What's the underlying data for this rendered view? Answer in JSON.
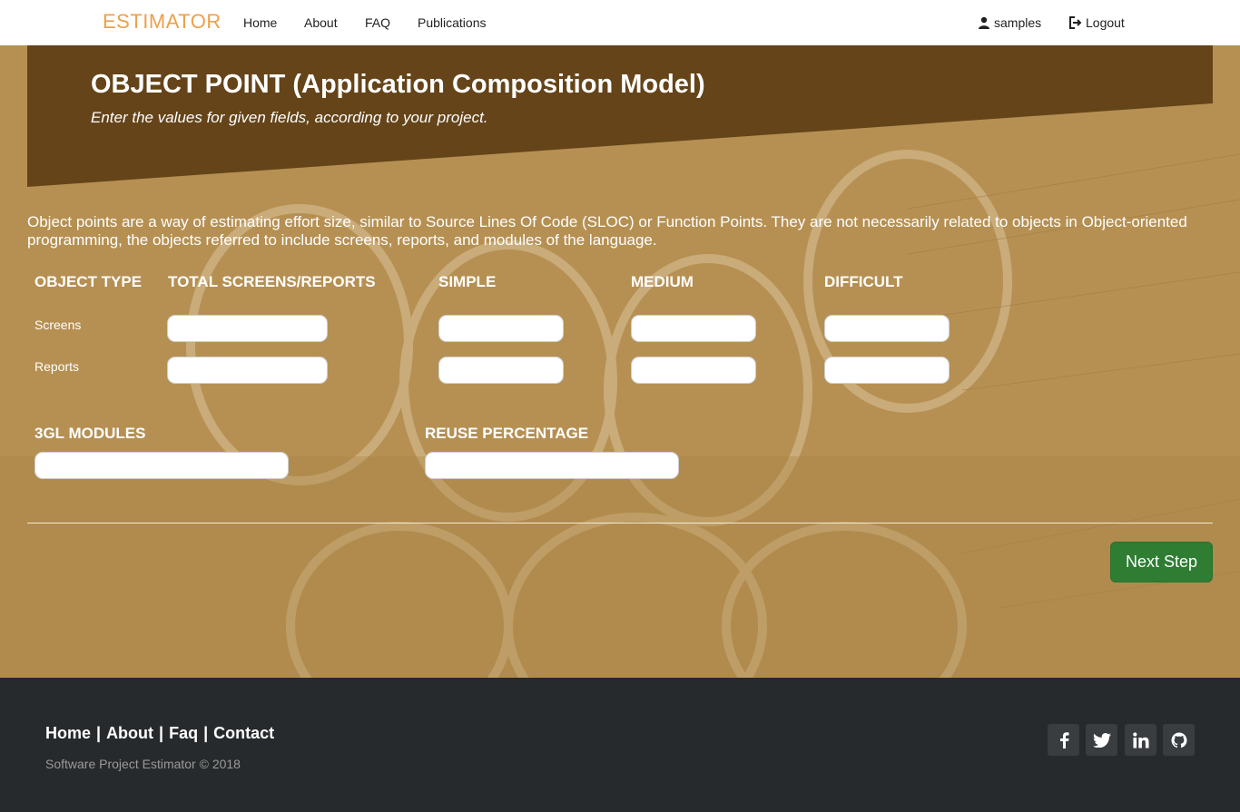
{
  "navbar": {
    "brand": "ESTIMATOR",
    "links": [
      "Home",
      "About",
      "FAQ",
      "Publications"
    ],
    "user": "samples",
    "logout": "Logout",
    "icons": {
      "user": "user-icon",
      "logout": "logout-icon"
    }
  },
  "banner": {
    "title": "OBJECT POINT (Application Composition Model)",
    "subtitle": "Enter the values for given fields, according to your project."
  },
  "description": "Object points are a way of estimating effort size, similar to Source Lines Of Code (SLOC) or Function Points. They are not necessarily related to objects in Object-oriented programming, the objects referred to include screens, reports, and modules of the language.",
  "table": {
    "headers": [
      "OBJECT TYPE",
      "TOTAL SCREENS/REPORTS",
      "SIMPLE",
      "MEDIUM",
      "DIFFICULT"
    ],
    "rows": [
      {
        "label": "Screens",
        "values": [
          "",
          "",
          "",
          ""
        ]
      },
      {
        "label": "Reports",
        "values": [
          "",
          "",
          "",
          ""
        ]
      }
    ]
  },
  "extra": {
    "modules_label": "3GL MODULES",
    "modules_value": "",
    "reuse_label": "REUSE PERCENTAGE",
    "reuse_value": ""
  },
  "actions": {
    "next": "Next Step"
  },
  "footer": {
    "links": [
      "Home",
      "About",
      "Faq",
      "Contact"
    ],
    "copyright": "Software Project Estimator © 2018",
    "social": [
      "facebook-icon",
      "twitter-icon",
      "linkedin-icon",
      "github-icon"
    ]
  },
  "colors": {
    "brand": "#eda04b",
    "banner": "#654419",
    "main_bg": "#b08a4a",
    "footer": "#272a2c",
    "next_button": "#2e7d32"
  }
}
